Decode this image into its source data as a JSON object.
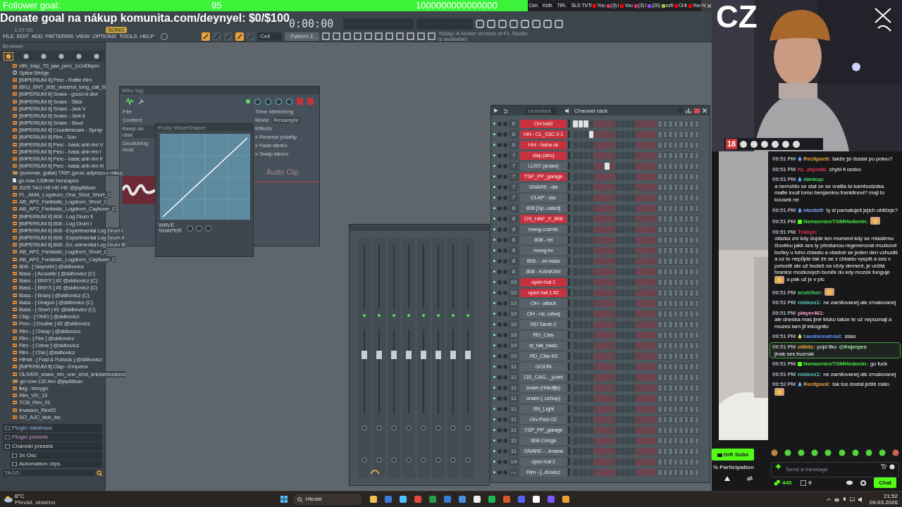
{
  "stream_overlay": {
    "follower_goal": {
      "label": "Follower goal:",
      "current": "95",
      "target": "1000000000000000"
    },
    "donate_goal": "Donate goal na nákup komunita.com/deynyel: $0/$100",
    "channel_tag": "CZ",
    "age_badge": "18"
  },
  "browser_tabs": [
    {
      "label": "Cen",
      "kind": "plain",
      "selected": false
    },
    {
      "label": "Knih",
      "kind": "cross",
      "selected": false
    },
    {
      "label": "TIR-",
      "kind": "cross",
      "selected": false
    },
    {
      "label": "SLS",
      "kind": "cross",
      "selected": false
    },
    {
      "label": "TVTi",
      "kind": "plain",
      "selected": false
    },
    {
      "label": "You",
      "kind": "video",
      "selected": false
    },
    {
      "label": "(3) I",
      "selected": false
    },
    {
      "label": "You",
      "kind": "video",
      "selected": false
    },
    {
      "label": "(3) I",
      "selected": false
    },
    {
      "label": "(20)",
      "kind": "stream",
      "selected": false
    },
    {
      "label": "ezfi",
      "kind": "leaf",
      "selected": false
    },
    {
      "label": "CHI",
      "kind": "video",
      "selected": false
    },
    {
      "label": "You",
      "kind": "video",
      "selected": false
    },
    {
      "label": "N",
      "kind": "plain",
      "selected": true
    }
  ],
  "fl_studio": {
    "song_position": "1:07:00",
    "mode": "SONG",
    "time": "0:00:00",
    "menu": [
      "FILE",
      "EDIT",
      "ADD",
      "PATTERNS",
      "VIEW",
      "OPTIONS",
      "TOOLS",
      "HELP"
    ],
    "snap": "Cell",
    "pattern": "Pattern 1",
    "news": "Today: A newer version of FL Studio is available!",
    "browser": {
      "title": "Browser",
      "items": [
        {
          "kind": "audio",
          "label": "cfrb_insp_70_jaw_perc_1x140bpm"
        },
        {
          "kind": "plugin",
          "label": "Splice Bridge"
        },
        {
          "kind": "audio",
          "label": "[IMPERIUM II] Perc - Rattle Rim"
        },
        {
          "kind": "audio",
          "label": "BKU_BNT_808_oneshot_long_cali_B"
        },
        {
          "kind": "audio",
          "label": "[IMPERIUM II] Snare - good ol dior"
        },
        {
          "kind": "audio",
          "label": "[IMPERIUM II] Snare - Stick"
        },
        {
          "kind": "audio",
          "label": "[IMPERIUM II] Snare - Jerk V"
        },
        {
          "kind": "audio",
          "label": "[IMPERIUM II] Snare - Jerk II"
        },
        {
          "kind": "audio",
          "label": "[IMPERIUM II] Snare - 'Bout"
        },
        {
          "kind": "audio",
          "label": "[IMPERIUM II] Countersnare - Spray"
        },
        {
          "kind": "audio",
          "label": "[IMPERIUM II] Rim - Sun"
        },
        {
          "kind": "audio",
          "label": "[IMPERIUM II] Perc - basic ahh rim V"
        },
        {
          "kind": "audio",
          "label": "[IMPERIUM II] Perc - basic ahh rim I"
        },
        {
          "kind": "audio",
          "label": "[IMPERIUM II] Perc - basic ahh rim II"
        },
        {
          "kind": "audio",
          "label": "[IMPERIUM II] Perc - basic ahh rim III"
        },
        {
          "kind": "project",
          "label": "(summer, guitar) TRIP..(prod. adymzo x miku)"
        },
        {
          "kind": "file",
          "label": "go now 133fmin honzapes"
        },
        {
          "kind": "audio",
          "label": "2025 TAG HE HE HE @jay88san"
        },
        {
          "kind": "audio",
          "label": "FL_AMA_Logdrum_One_Shot_Short_C"
        },
        {
          "kind": "audio",
          "label": "AB_AP2_Fantastic_Logdrum_Short_C"
        },
        {
          "kind": "audio",
          "label": "AB_AP2_Fantastic_Logdrum_Captown_C"
        },
        {
          "kind": "audio",
          "label": "[IMPERIUM II] 808 - Log Drum II"
        },
        {
          "kind": "audio",
          "label": "[IMPERIUM II] 808 - Log Drum I"
        },
        {
          "kind": "audio",
          "label": "[IMPERIUM II] 808 - Experimental Log Drum I"
        },
        {
          "kind": "audio",
          "label": "[IMPERIUM II] 808 - Experimental Log Drum II"
        },
        {
          "kind": "audio",
          "label": "[IMPERIUM II] 808 - Ex..erimental Log Drum III"
        },
        {
          "kind": "audio",
          "label": "AB_AP2_Fantastic_Logdrum_Short_C"
        },
        {
          "kind": "audio",
          "label": "AB_AP2_Fantastic_Logdrum_Captown_C"
        },
        {
          "kind": "audio",
          "label": "808 - [ Slaywrld ] @skibovicz"
        },
        {
          "kind": "audio",
          "label": "Bass - [ Acoustic ] @skibovicz (C)"
        },
        {
          "kind": "audio",
          "label": "Bass - [ BNYX ] #2 @skibovicz (C)"
        },
        {
          "kind": "audio",
          "label": "Bass - [ BNYX ] #1 @skibovicz (C)"
        },
        {
          "kind": "audio",
          "label": "Bass - [ Brazy ] @skibovicz (C)"
        },
        {
          "kind": "audio",
          "label": "Bass - [ Dragon ] @skibovicz (C)"
        },
        {
          "kind": "audio",
          "label": "Bass - [ Short ] #1 @skibovicz (C)"
        },
        {
          "kind": "audio",
          "label": "Clap - [ OMG ] @skibovicz"
        },
        {
          "kind": "audio",
          "label": "Perc - [ Double ] #2 @skibovicz"
        },
        {
          "kind": "audio",
          "label": "Rim - [ Cheap ] @skibovicz"
        },
        {
          "kind": "audio",
          "label": "Rim - [ Fire ] @skibovicz"
        },
        {
          "kind": "audio",
          "label": "Rim - [ Crime ] @skibovicz"
        },
        {
          "kind": "audio",
          "label": "Rim - [ Cha ] @skibovicz"
        },
        {
          "kind": "audio",
          "label": "HiHat - [ Fast & Furious ] @skibovicz"
        },
        {
          "kind": "audio",
          "label": "[IMPERIUM II] Clap - Emperor"
        },
        {
          "kind": "audio",
          "label": "OLIVER_snare_rim_one_shot_knickerbockers"
        },
        {
          "kind": "project",
          "label": "go now 132 Am @jay88san"
        },
        {
          "kind": "audio",
          "label": "flag - txmygn"
        },
        {
          "kind": "audio",
          "label": "Rim_VD_15"
        },
        {
          "kind": "audio",
          "label": "TCB_Rim_01"
        },
        {
          "kind": "audio",
          "label": "Invasion_Rim02"
        },
        {
          "kind": "audio",
          "label": "SO_AJC_kick_iss"
        }
      ],
      "sections": [
        {
          "kind": "plugin",
          "label": "Plugin database"
        },
        {
          "kind": "preset",
          "label": "Plugin presets"
        },
        {
          "kind": "folder",
          "label": "Channel presets",
          "children": [
            {
              "label": "3x Osc"
            },
            {
              "label": "Automation clips"
            }
          ]
        }
      ],
      "tags_label": "TAGS"
    },
    "sample_window": {
      "title": "Miku tag",
      "file_label": "File",
      "content": "Content",
      "keep_on_disk": "Keep on disk",
      "declicking": "Declicking mod",
      "time_stretching": "Time stretching",
      "mode": "Mode",
      "resample": "Resample",
      "effects": "Effects",
      "options": [
        "Reverse polarity",
        "Fade stereo",
        "Swap stereo"
      ],
      "clip_label": "Audio Clip",
      "waveshaper": {
        "title": "Fruity WaveShaper",
        "logo": "WAVE SHAPER"
      }
    },
    "channel_rack": {
      "filter": "Unsorted",
      "title": "Channel rack",
      "rows": [
        {
          "number": "6",
          "name": "CH hat2",
          "selected": true,
          "steps": [
            true,
            true,
            true,
            false,
            false,
            false,
            false,
            false,
            false,
            false,
            false,
            false,
            false,
            false,
            false,
            false
          ]
        },
        {
          "number": "6",
          "name": "HH - CL_S3C 0 1",
          "selected": true,
          "steps": [
            false,
            false,
            false,
            true,
            false,
            false,
            false,
            false,
            false,
            false,
            false,
            false,
            false,
            false,
            false,
            false
          ]
        },
        {
          "number": "6",
          "name": "HH - haha uk",
          "selected": true,
          "steps": [
            false,
            false,
            false,
            false,
            false,
            false,
            false,
            false,
            false,
            false,
            false,
            false,
            false,
            false,
            false,
            false
          ]
        },
        {
          "number": "7",
          "name": "clap (abc)",
          "selected": true,
          "steps": [
            false,
            false,
            false,
            false,
            false,
            false,
            false,
            false,
            false,
            false,
            false,
            false,
            false,
            false,
            false,
            false
          ]
        },
        {
          "number": "7",
          "name": "LUST (snare)",
          "selected": false,
          "steps": [
            false,
            false,
            false,
            false,
            false,
            false,
            true,
            false,
            false,
            false,
            false,
            false,
            false,
            false,
            false,
            false
          ]
        },
        {
          "number": "7",
          "name": "TSP_PP_garage",
          "selected": true,
          "steps": [
            false,
            false,
            false,
            false,
            false,
            false,
            false,
            false,
            false,
            false,
            false,
            false,
            false,
            false,
            false,
            false
          ]
        },
        {
          "number": "7",
          "name": "SNARE - die",
          "selected": false,
          "steps": [
            false,
            false,
            false,
            false,
            false,
            false,
            false,
            false,
            false,
            false,
            false,
            false,
            false,
            false,
            false,
            false
          ]
        },
        {
          "number": "7",
          "name": "CLAP - ssc",
          "selected": false,
          "steps": [
            false,
            false,
            false,
            false,
            false,
            false,
            false,
            false,
            false,
            false,
            false,
            false,
            false,
            false,
            false,
            false
          ]
        },
        {
          "number": "8",
          "name": "808 [Sp..oated]",
          "selected": false,
          "steps": [
            false,
            false,
            false,
            false,
            false,
            false,
            false,
            false,
            false,
            false,
            false,
            false,
            false,
            false,
            false,
            false
          ]
        },
        {
          "number": "8",
          "name": "OS_HAF_X_808",
          "selected": true,
          "steps": [
            false,
            false,
            false,
            false,
            false,
            false,
            false,
            false,
            false,
            false,
            false,
            false,
            false,
            false,
            false,
            false
          ]
        },
        {
          "number": "8",
          "name": "moog cosmic",
          "selected": false,
          "steps": [
            false,
            false,
            false,
            false,
            false,
            false,
            false,
            false,
            false,
            false,
            false,
            false,
            false,
            false,
            false,
            false
          ]
        },
        {
          "number": "8",
          "name": "808 - rel",
          "selected": false,
          "steps": [
            false,
            false,
            false,
            false,
            false,
            false,
            false,
            false,
            false,
            false,
            false,
            false,
            false,
            false,
            false,
            false
          ]
        },
        {
          "number": "8",
          "name": "moog bv",
          "selected": false,
          "steps": [
            false,
            false,
            false,
            false,
            false,
            false,
            false,
            false,
            false,
            false,
            false,
            false,
            false,
            false,
            false,
            false
          ]
        },
        {
          "number": "8",
          "name": "808 - ..en bass",
          "selected": false,
          "steps": [
            false,
            false,
            false,
            false,
            false,
            false,
            false,
            false,
            false,
            false,
            false,
            false,
            false,
            false,
            false,
            false
          ]
        },
        {
          "number": "8",
          "name": "808 - KANKAN",
          "selected": false,
          "steps": [
            false,
            false,
            false,
            false,
            false,
            false,
            false,
            false,
            false,
            false,
            false,
            false,
            false,
            false,
            false,
            false
          ]
        },
        {
          "number": "10",
          "name": "open hat 1",
          "selected": true,
          "steps": [
            false,
            false,
            false,
            false,
            false,
            false,
            false,
            false,
            false,
            false,
            false,
            false,
            false,
            false,
            false,
            false
          ]
        },
        {
          "number": "10",
          "name": "open hat 1 #2",
          "selected": true,
          "steps": [
            false,
            false,
            false,
            false,
            false,
            false,
            false,
            false,
            false,
            false,
            false,
            false,
            false,
            false,
            false,
            false
          ]
        },
        {
          "number": "10",
          "name": "OH - attack",
          "selected": false,
          "steps": [
            false,
            false,
            false,
            false,
            false,
            false,
            false,
            false,
            false,
            false,
            false,
            false,
            false,
            false,
            false,
            false
          ]
        },
        {
          "number": "10",
          "name": "OH - ne..uzivej",
          "selected": false,
          "steps": [
            false,
            false,
            false,
            false,
            false,
            false,
            false,
            false,
            false,
            false,
            false,
            false,
            false,
            false,
            false,
            false
          ]
        },
        {
          "number": "10",
          "name": "RD Tamb 2",
          "selected": false,
          "steps": [
            false,
            false,
            false,
            false,
            false,
            false,
            false,
            false,
            false,
            false,
            false,
            false,
            false,
            false,
            false,
            false
          ]
        },
        {
          "number": "10",
          "name": "RD_Clav",
          "selected": false,
          "steps": [
            false,
            false,
            false,
            false,
            false,
            false,
            false,
            false,
            false,
            false,
            false,
            false,
            false,
            false,
            false,
            false
          ]
        },
        {
          "number": "10",
          "name": "st_hat_basic",
          "selected": false,
          "steps": [
            false,
            false,
            false,
            false,
            false,
            false,
            false,
            false,
            false,
            false,
            false,
            false,
            false,
            false,
            false,
            false
          ]
        },
        {
          "number": "10",
          "name": "RD_Clav #3",
          "selected": false,
          "steps": [
            false,
            false,
            false,
            false,
            false,
            false,
            false,
            false,
            false,
            false,
            false,
            false,
            false,
            false,
            false,
            false
          ]
        },
        {
          "number": "11",
          "name": "GOON",
          "selected": false,
          "steps": [
            false,
            false,
            false,
            false,
            false,
            false,
            false,
            false,
            false,
            false,
            false,
            false,
            false,
            false,
            false,
            false
          ]
        },
        {
          "number": "11",
          "name": "OS_CAS..._point",
          "selected": false,
          "steps": [
            false,
            false,
            false,
            false,
            false,
            false,
            false,
            false,
            false,
            false,
            false,
            false,
            false,
            false,
            false,
            false
          ]
        },
        {
          "number": "11",
          "name": "snare (nhkdfjls)",
          "selected": false,
          "steps": [
            false,
            false,
            false,
            false,
            false,
            false,
            false,
            false,
            false,
            false,
            false,
            false,
            false,
            false,
            false,
            false
          ]
        },
        {
          "number": "11",
          "name": "snare (..uchop)",
          "selected": false,
          "steps": [
            false,
            false,
            false,
            false,
            false,
            false,
            false,
            false,
            false,
            false,
            false,
            false,
            false,
            false,
            false,
            false
          ]
        },
        {
          "number": "11",
          "name": "SN_Light",
          "selected": false,
          "steps": [
            false,
            false,
            false,
            false,
            false,
            false,
            false,
            false,
            false,
            false,
            false,
            false,
            false,
            false,
            false,
            false
          ]
        },
        {
          "number": "11",
          "name": "Grv Perc 02",
          "selected": false,
          "steps": [
            false,
            false,
            false,
            false,
            false,
            false,
            false,
            false,
            false,
            false,
            false,
            false,
            false,
            false,
            false,
            false
          ]
        },
        {
          "number": "11",
          "name": "TSP_PP_garage",
          "selected": false,
          "steps": [
            false,
            false,
            false,
            false,
            false,
            false,
            false,
            false,
            false,
            false,
            false,
            false,
            false,
            false,
            false,
            false
          ]
        },
        {
          "number": "11",
          "name": "808 Conga",
          "selected": false,
          "steps": [
            false,
            false,
            false,
            false,
            false,
            false,
            false,
            false,
            false,
            false,
            false,
            false,
            false,
            false,
            false,
            false
          ]
        },
        {
          "number": "11",
          "name": "SNARE - ..tmana",
          "selected": false,
          "steps": [
            false,
            false,
            false,
            false,
            false,
            false,
            false,
            false,
            false,
            false,
            false,
            false,
            false,
            false,
            false,
            false
          ]
        },
        {
          "number": "14",
          "name": "open hat 2",
          "selected": false,
          "steps": [
            false,
            false,
            false,
            false,
            false,
            false,
            false,
            false,
            false,
            false,
            false,
            false,
            false,
            false,
            false,
            false
          ]
        },
        {
          "number": "---",
          "name": "Rim - [...ibovicz",
          "selected": false,
          "steps": [
            false,
            false,
            false,
            false,
            false,
            false,
            false,
            false,
            false,
            false,
            false,
            false,
            false,
            false,
            false,
            false
          ]
        }
      ]
    }
  },
  "chat": {
    "messages": [
      {
        "time": "09:51 PM",
        "kind": "drop",
        "user": "Reclipse6:",
        "color": "#e8a33a",
        "highlighted": false,
        "parts": [
          {
            "kind": "text",
            "text": "takže jsi dostal po právu?"
          }
        ]
      },
      {
        "time": "09:51 PM",
        "kind": "plain",
        "user": "ltz_zbynda:",
        "color": "#e0334b",
        "highlighted": false,
        "parts": [
          {
            "kind": "text",
            "text": "chybi ti cesko"
          }
        ]
      },
      {
        "time": "09:51 PM",
        "kind": "drop",
        "user": "dankop:",
        "color": "#3fcf5b",
        "highlighted": false,
        "parts": [
          {
            "kind": "text",
            "text": "a nemohlo se stat ze se vratila ta kambodzska mafie kvuli tomu benjaminu franklinovi? maji to kousek ne"
          }
        ]
      },
      {
        "time": "09:51 PM",
        "kind": "drop",
        "user": "nicoto9:",
        "color": "#8aa2ff",
        "highlighted": false,
        "parts": [
          {
            "kind": "text",
            "text": "ty si pamatuješ jejich obličeje?"
          }
        ]
      },
      {
        "time": "09:51 PM",
        "kind": "gift",
        "user": "NemocniceTGMHodonin:",
        "color": "#44e23a",
        "highlighted": false,
        "parts": [
          {
            "kind": "emote"
          }
        ]
      },
      {
        "time": "09:51 PM",
        "kind": "plain",
        "user": "Tekkys:",
        "color": "#e0334b",
        "highlighted": false,
        "parts": [
          {
            "kind": "text",
            "text": "otázka zní kdy dojde ten moment kdy se mladému člověku jakk ses ty přestanou regenerovat mozkové buňky u toho chlastu a vlastně se jeden den vzbudiš a uz to nepůjde tak že se z chlastu vyspiš a ses v pohodě ale už budeš na vždy dement, je určitá hranice mozkových buněk do kdy mozek funguje"
          },
          {
            "kind": "emote"
          },
          {
            "kind": "text",
            "text": "a pak už je v pic"
          }
        ]
      },
      {
        "time": "09:51 PM",
        "kind": "plain",
        "user": "anstriber:",
        "color": "#3fcf5b",
        "highlighted": false,
        "parts": [
          {
            "kind": "emote"
          }
        ]
      },
      {
        "time": "09:51 PM",
        "kind": "plain",
        "user": "miskos1:",
        "color": "#4fc8b0",
        "highlighted": false,
        "parts": [
          {
            "kind": "text",
            "text": "ne zamilovanej ale zmalovanej"
          }
        ]
      },
      {
        "time": "09:51 PM",
        "kind": "plain",
        "user": "player461:",
        "color": "#f29bc0",
        "highlighted": false,
        "parts": [
          {
            "kind": "text",
            "text": "ale dneska mas jiné tricko takze te už nepoznaji a muzes tam jit inkognito"
          }
        ]
      },
      {
        "time": "09:51 PM",
        "kind": "bulb",
        "user": "harabinnahrad:",
        "color": "#5b8de8",
        "highlighted": false,
        "parts": [
          {
            "kind": "text",
            "text": "stalo"
          }
        ]
      },
      {
        "time": "09:51 PM",
        "kind": "plain",
        "user": "olibitz:",
        "color": "#e8a33a",
        "highlighted": true,
        "parts": [
          {
            "kind": "text",
            "text": "pojd fiko"
          },
          {
            "kind": "mention",
            "text": "@frajerpes"
          },
          {
            "kind": "text",
            "text": "jinak ses buznak"
          }
        ]
      },
      {
        "time": "09:51 PM",
        "kind": "gift",
        "user": "NemocniceTGMHodonin:",
        "color": "#44e23a",
        "highlighted": false,
        "parts": [
          {
            "kind": "text",
            "text": "go fuck"
          }
        ]
      },
      {
        "time": "09:51 PM",
        "kind": "plain",
        "user": "miskos1:",
        "color": "#4fc8b0",
        "highlighted": false,
        "parts": [
          {
            "kind": "text",
            "text": "ne zamilovanej ale zmalovanej"
          }
        ]
      },
      {
        "time": "09:52 PM",
        "kind": "drop",
        "user": "Reclipse6:",
        "color": "#e8a33a",
        "highlighted": false,
        "parts": [
          {
            "kind": "text",
            "text": "tak tos dostal ještě málo"
          },
          {
            "kind": "emote"
          }
        ]
      }
    ],
    "input": {
      "placeholder": "Send a message"
    },
    "points": "440",
    "drops": "0",
    "send_button": "Chat",
    "gift_button": "Gift Subs",
    "participation": "% Participation"
  },
  "taskbar": {
    "temperature": "8°C",
    "weather": "Převáž. oblačno",
    "search_placeholder": "Hledat",
    "time": "21:52",
    "date": "09.03.2026"
  }
}
